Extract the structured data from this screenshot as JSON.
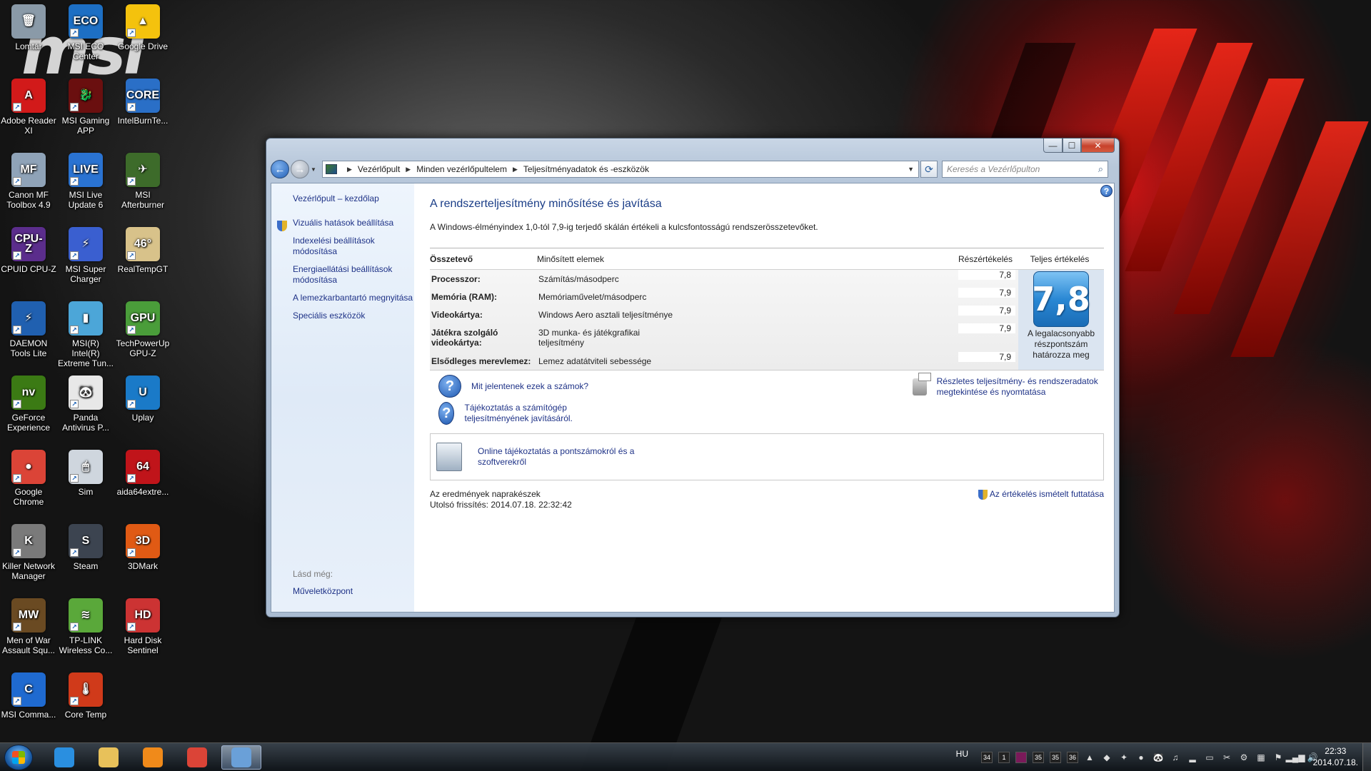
{
  "desktop": {
    "icons": [
      {
        "label": "Lomtár",
        "glyph": "🗑",
        "color": "#8a9aa8"
      },
      {
        "label": "MSI ECO Center",
        "glyph": "ECO",
        "color": "#1d6fc4"
      },
      {
        "label": "Google Drive",
        "glyph": "▲",
        "color": "#f4c20d"
      },
      {
        "label": "Adobe Reader XI",
        "glyph": "A",
        "color": "#d21a1a"
      },
      {
        "label": "MSI Gaming APP",
        "glyph": "🐉",
        "color": "#6a0f0f"
      },
      {
        "label": "IntelBurnTe...",
        "glyph": "CORE",
        "color": "#2a6fc7"
      },
      {
        "label": "Canon MF Toolbox 4.9",
        "glyph": "MF",
        "color": "#8fa3b8"
      },
      {
        "label": "MSI Live Update 6",
        "glyph": "LIVE",
        "color": "#2a73d2"
      },
      {
        "label": "MSI Afterburner",
        "glyph": "✈",
        "color": "#3d6b2a"
      },
      {
        "label": "CPUID CPU-Z",
        "glyph": "CPU-Z",
        "color": "#5b2d8c"
      },
      {
        "label": "MSI Super Charger",
        "glyph": "⚡",
        "color": "#3a5fd0"
      },
      {
        "label": "RealTempGT",
        "glyph": "46°",
        "color": "#d8c28a"
      },
      {
        "label": "DAEMON Tools Lite",
        "glyph": "⚡",
        "color": "#2060b0"
      },
      {
        "label": "MSI(R) Intel(R) Extreme Tun...",
        "glyph": "▮",
        "color": "#4ca6d8"
      },
      {
        "label": "TechPowerUp GPU-Z",
        "glyph": "GPU",
        "color": "#4a9d3a"
      },
      {
        "label": "GeForce Experience",
        "glyph": "nv",
        "color": "#3b7a14"
      },
      {
        "label": "Panda Antivirus P...",
        "glyph": "🐼",
        "color": "#e8e8e8"
      },
      {
        "label": "Uplay",
        "glyph": "U",
        "color": "#1a7ac8"
      },
      {
        "label": "Google Chrome",
        "glyph": "●",
        "color": "#db4437"
      },
      {
        "label": "Sim",
        "glyph": "🖱",
        "color": "#cfd6de"
      },
      {
        "label": "aida64extre...",
        "glyph": "64",
        "color": "#c0141a"
      },
      {
        "label": "Killer Network Manager",
        "glyph": "K",
        "color": "#7a7a7a"
      },
      {
        "label": "Steam",
        "glyph": "S",
        "color": "#3c4450"
      },
      {
        "label": "3DMark",
        "glyph": "3D",
        "color": "#e05a14"
      },
      {
        "label": "Men of War Assault Squ...",
        "glyph": "MW",
        "color": "#6a4a22"
      },
      {
        "label": "TP-LINK Wireless Co...",
        "glyph": "≋",
        "color": "#5aa83a"
      },
      {
        "label": "Hard Disk Sentinel",
        "glyph": "HD",
        "color": "#c33"
      },
      {
        "label": "MSI Comma...",
        "glyph": "C",
        "color": "#1f6ad0"
      },
      {
        "label": "Core Temp",
        "glyph": "🌡",
        "color": "#d03a1a"
      }
    ]
  },
  "window": {
    "controls": {
      "minimize": "—",
      "maximize": "☐",
      "close": "✕"
    },
    "breadcrumb": [
      "Vezérlőpult",
      "Minden vezérlőpultelem",
      "Teljesítményadatok és -eszközök"
    ],
    "search_placeholder": "Keresés a Vezérlőpulton",
    "left_pane": {
      "home": "Vezérlőpult – kezdőlap",
      "links": [
        "Vizuális hatások beállítása",
        "Indexelési beállítások módosítása",
        "Energiaellátási beállítások módosítása",
        "A lemezkarbantartó megnyitása",
        "Speciális eszközök"
      ],
      "see_also_title": "Lásd még:",
      "see_also_link": "Műveletközpont"
    },
    "main": {
      "title": "A rendszerteljesítmény minősítése és javítása",
      "description": "A Windows-élményindex 1,0-tól 7,9-ig terjedő skálán értékeli a kulcsfontosságú rendszerösszetevőket.",
      "headers": {
        "component": "Összetevő",
        "rated": "Minősített elemek",
        "subscore": "Részértékelés",
        "base": "Teljes értékelés"
      },
      "rows": [
        {
          "component": "Processzor:",
          "rated": "Számítás/másodperc",
          "score": "7,8"
        },
        {
          "component": "Memória (RAM):",
          "rated": "Memóriaművelet/másodperc",
          "score": "7,9"
        },
        {
          "component": "Videokártya:",
          "rated": "Windows Aero asztali teljesítménye",
          "score": "7,9"
        },
        {
          "component": "Játékra szolgáló videokártya:",
          "rated": "3D munka- és játékgrafikai teljesítmény",
          "score": "7,9"
        },
        {
          "component": "Elsődleges merevlemez:",
          "rated": "Lemez adatátviteli sebessége",
          "score": "7,9"
        }
      ],
      "base_score": "7,8",
      "base_note": "A legalacsonyabb részpontszám határozza meg",
      "link_numbers": "Mit jelentenek ezek a számok?",
      "link_tips": "Tájékoztatás a számítógép teljesítményének javításáról.",
      "link_details": "Részletes teljesítmény- és rendszeradatok megtekintése és nyomtatása",
      "online_link": "Online tájékoztatás a pontszámokról és a szoftverekről",
      "status": "Az eredmények naprakészek",
      "last_update": "Utolsó frissítés: 2014.07.18. 22:32:42",
      "rerun": "Az értékelés ismételt futtatása"
    }
  },
  "taskbar": {
    "apps": [
      {
        "name": "internet-explorer",
        "color": "#2a8fe0"
      },
      {
        "name": "windows-explorer",
        "color": "#e8c15a"
      },
      {
        "name": "media-player",
        "color": "#f08a1a"
      },
      {
        "name": "google-chrome",
        "color": "#db4437"
      },
      {
        "name": "control-panel",
        "color": "#6aa0d8"
      }
    ],
    "language": "HU",
    "tray_icons": [
      "34",
      "1",
      "",
      "35",
      "35",
      "36"
    ],
    "time": "22:33",
    "date": "2014.07.18."
  }
}
